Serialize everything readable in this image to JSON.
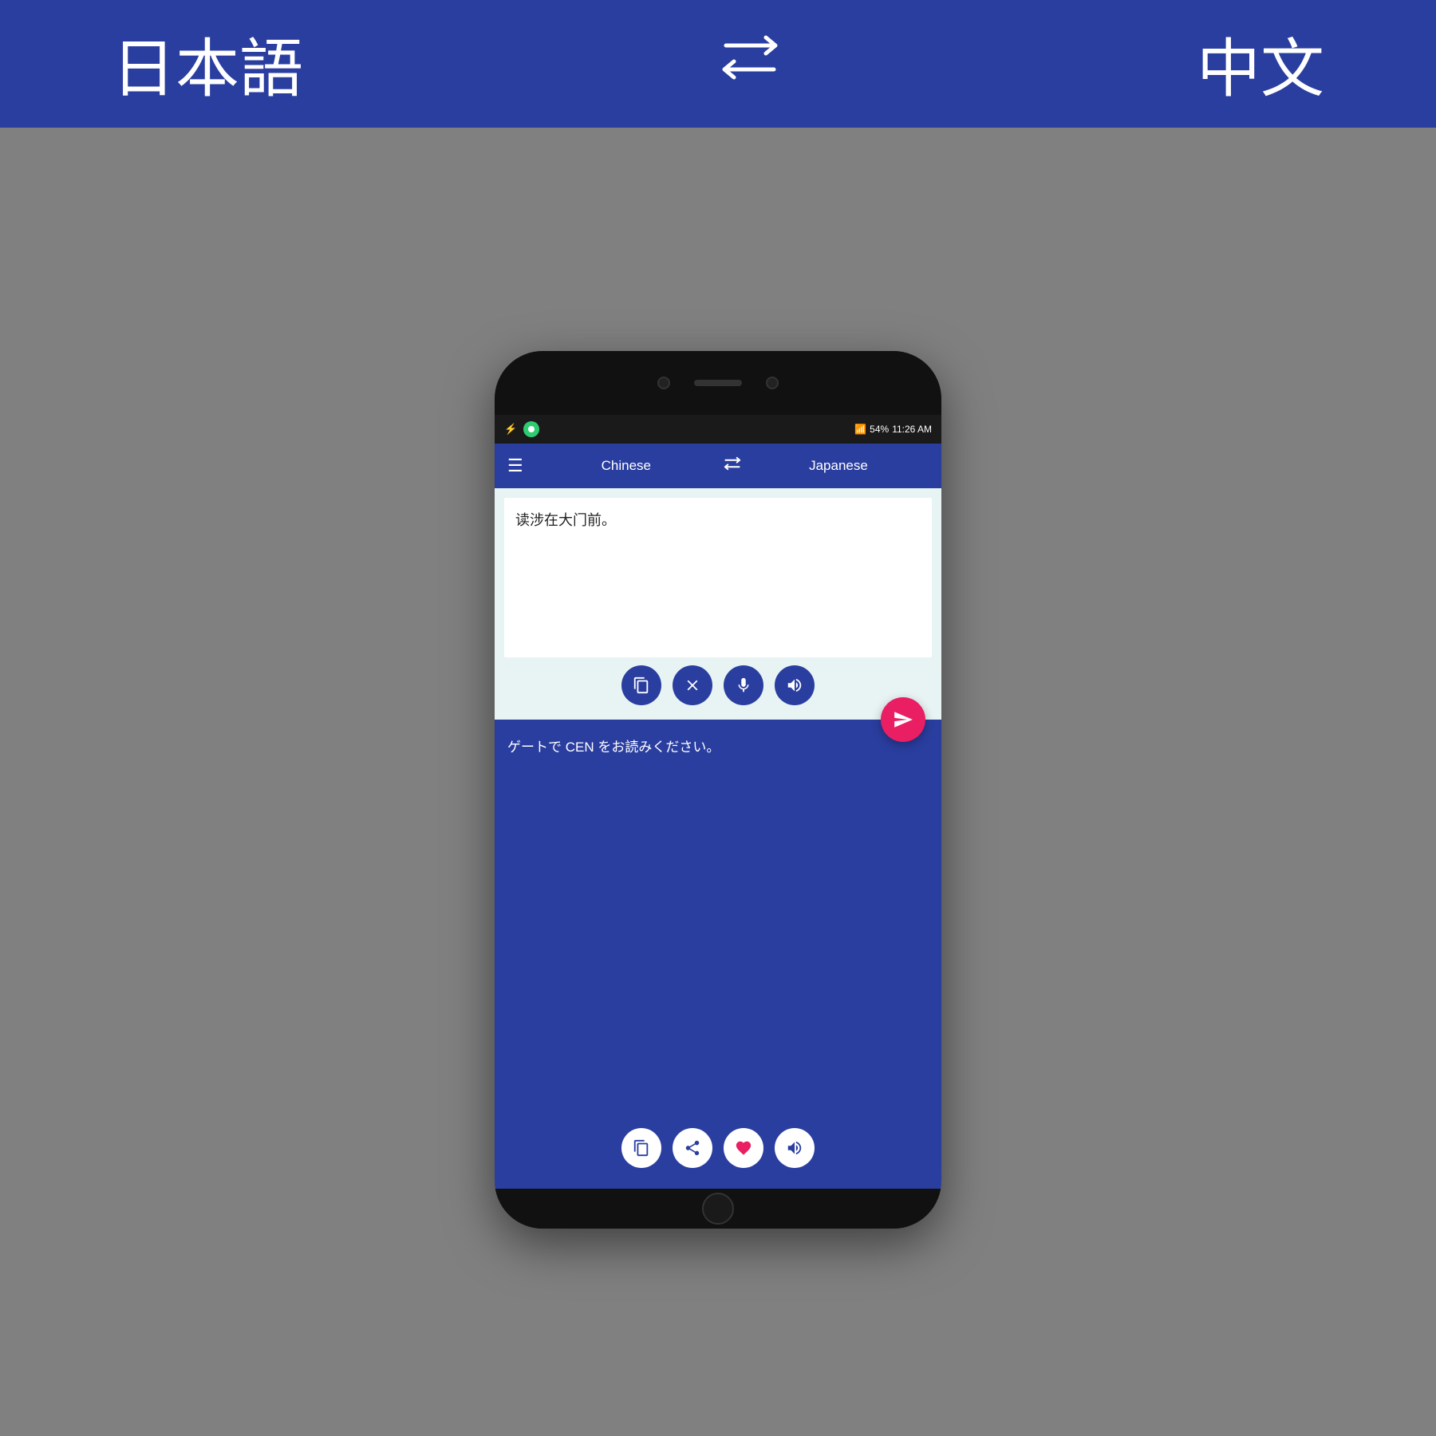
{
  "header": {
    "lang_left": "日本語",
    "lang_right": "中文",
    "swap_symbol": "⇄"
  },
  "status_bar": {
    "battery": "54%",
    "time": "11:26 AM"
  },
  "toolbar": {
    "hamburger": "☰",
    "lang_left": "Chinese",
    "swap": "⇄",
    "lang_right": "Japanese"
  },
  "input": {
    "text": "读涉在大门前。"
  },
  "output": {
    "text": "ゲートで CEN をお読みください。"
  },
  "buttons": {
    "clipboard": "clipboard-icon",
    "clear": "clear-icon",
    "mic": "mic-icon",
    "speaker": "speaker-icon",
    "translate": "send-icon",
    "copy": "copy-icon",
    "share": "share-icon",
    "favorite": "heart-icon",
    "speaker_out": "speaker-out-icon"
  }
}
